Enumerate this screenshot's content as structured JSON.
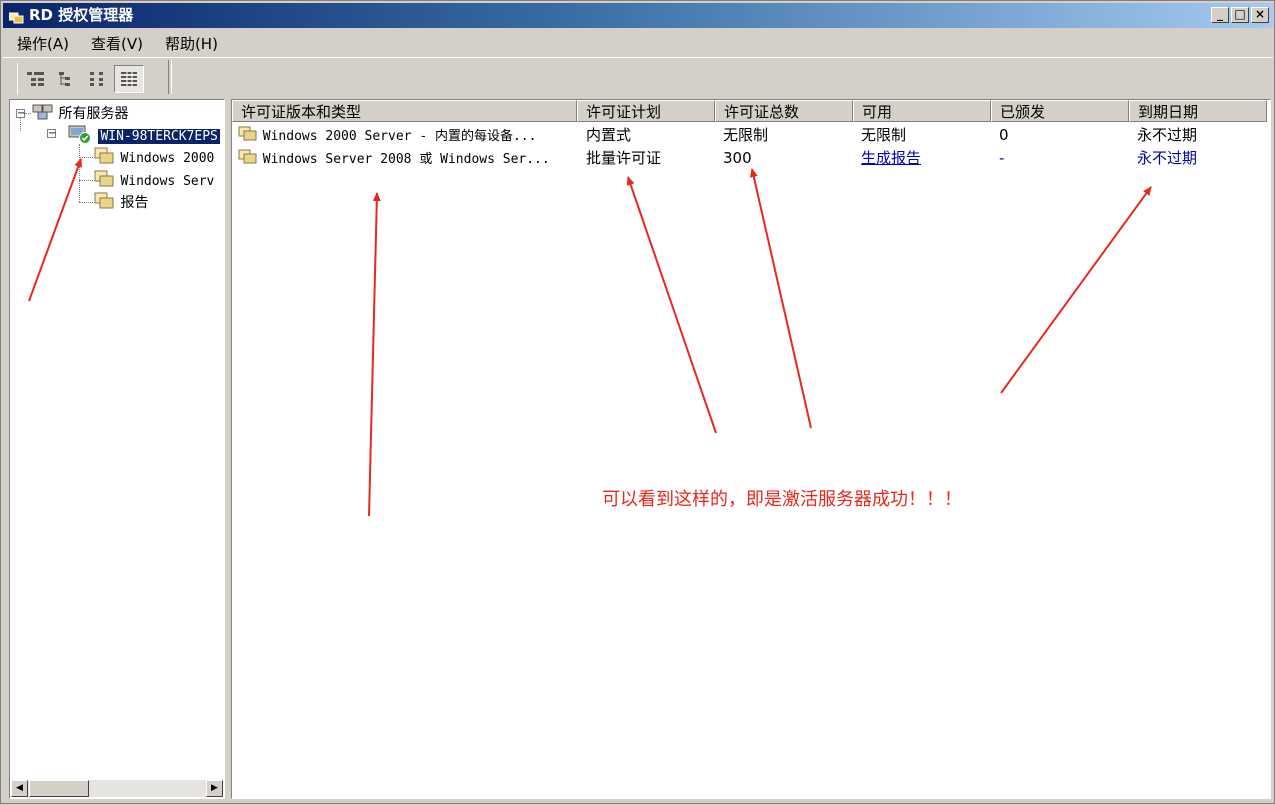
{
  "window": {
    "title": "RD 授权管理器",
    "controls": {
      "minimize": "_",
      "maximize": "□",
      "close": "×"
    }
  },
  "menu": [
    "操作(A)",
    "查看(V)",
    "帮助(H)"
  ],
  "toolbar": {
    "buttons": [
      "tree-view-icon",
      "org-view-icon",
      "small-icons-view-icon",
      "details-view-icon"
    ],
    "pressed": "details-view-icon"
  },
  "tree": {
    "root": "所有服务器",
    "server": "WIN-98TERCK7EPS",
    "children": [
      "Windows 2000",
      "Windows Serv",
      "报告"
    ]
  },
  "list": {
    "columns": [
      "许可证版本和类型",
      "许可证计划",
      "许可证总数",
      "可用",
      "已颁发",
      "到期日期"
    ],
    "rows": [
      [
        "Windows 2000 Server - 内置的每设备...",
        "内置式",
        "无限制",
        "无限制",
        "0",
        "永不过期"
      ],
      [
        "Windows Server 2008 或 Windows Ser...",
        "批量许可证",
        "300",
        "生成报告",
        "-",
        "永不过期"
      ]
    ]
  },
  "annotation": "可以看到这样的，即是激活服务器成功！！！",
  "colors": {
    "annotation": "#e8281e",
    "selection": "#0a246a",
    "link": "#0000c0"
  }
}
